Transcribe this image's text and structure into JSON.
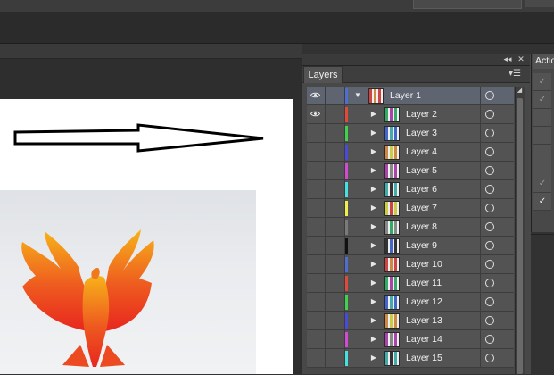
{
  "panel": {
    "tab_title": "Layers",
    "collapse_icon": "double-chevron-left-icon",
    "close_icon": "close-icon",
    "menu_icon": "panel-menu-icon"
  },
  "actions_panel": {
    "tab_title": "Actio"
  },
  "layers": [
    {
      "name": "Layer 1",
      "color": "#4f6fd0",
      "expanded": true,
      "selected": true,
      "visible": true
    },
    {
      "name": "Layer 2",
      "color": "#e04a3a",
      "expanded": false,
      "selected": false,
      "visible": true
    },
    {
      "name": "Layer 3",
      "color": "#3fd24a",
      "expanded": false,
      "selected": false,
      "visible": false
    },
    {
      "name": "Layer 4",
      "color": "#4a4ad8",
      "expanded": false,
      "selected": false,
      "visible": false
    },
    {
      "name": "Layer 5",
      "color": "#d24ad2",
      "expanded": false,
      "selected": false,
      "visible": false
    },
    {
      "name": "Layer 6",
      "color": "#46e0e0",
      "expanded": false,
      "selected": false,
      "visible": false
    },
    {
      "name": "Layer 7",
      "color": "#f0ee4a",
      "expanded": false,
      "selected": false,
      "visible": false
    },
    {
      "name": "Layer 8",
      "color": "#7a7a7a",
      "expanded": false,
      "selected": false,
      "visible": false
    },
    {
      "name": "Layer 9",
      "color": "#111111",
      "expanded": false,
      "selected": false,
      "visible": false
    },
    {
      "name": "Layer 10",
      "color": "#4f6fd0",
      "expanded": false,
      "selected": false,
      "visible": false
    },
    {
      "name": "Layer 11",
      "color": "#e04a3a",
      "expanded": false,
      "selected": false,
      "visible": false
    },
    {
      "name": "Layer 12",
      "color": "#3fd24a",
      "expanded": false,
      "selected": false,
      "visible": false
    },
    {
      "name": "Layer 13",
      "color": "#4a4ad8",
      "expanded": false,
      "selected": false,
      "visible": false
    },
    {
      "name": "Layer 14",
      "color": "#d24ad2",
      "expanded": false,
      "selected": false,
      "visible": false
    },
    {
      "name": "Layer 15",
      "color": "#46e0e0",
      "expanded": false,
      "selected": false,
      "visible": false
    }
  ],
  "colors": {
    "panel_bg": "#484848",
    "row_bg": "#535353",
    "selected_row_bg": "#5e6470",
    "phoenix_top": "#f7b21a",
    "phoenix_bottom": "#e8261f"
  }
}
